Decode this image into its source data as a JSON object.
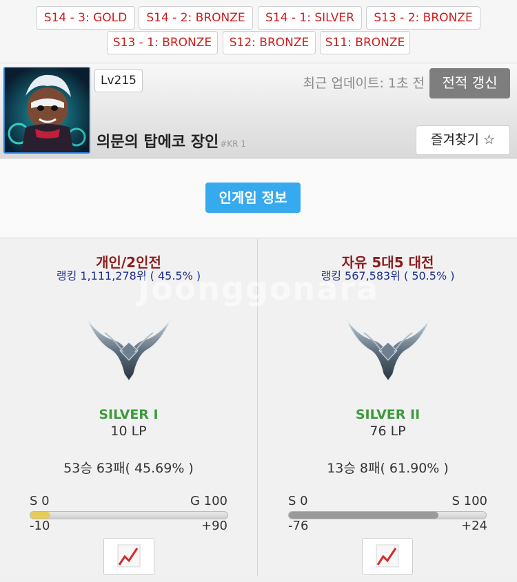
{
  "seasons": [
    {
      "label": "S14 - 3: GOLD"
    },
    {
      "label": "S14 - 2: BRONZE"
    },
    {
      "label": "S14 - 1: SILVER"
    },
    {
      "label": "S13 - 2: BRONZE"
    },
    {
      "label": "S13 - 1: BRONZE"
    },
    {
      "label": "S12: BRONZE"
    },
    {
      "label": "S11: BRONZE"
    }
  ],
  "profile": {
    "level": "Lv215",
    "last_update": "최근 업데이트: 1초 전",
    "refresh_label": "전적 갱신",
    "summoner_name": "의문의 탑에코 장인",
    "tag": "#KR 1",
    "favorite_label": "즐겨찾기 ☆"
  },
  "ingame_label": "인게임 정보",
  "watermark": "Joonggonara",
  "queues": [
    {
      "name": "개인/2인전",
      "ranking": "랭킹 1,111,278위 ( 45.5% )",
      "tier": "SILVER I",
      "lp": "10 LP",
      "record": "53승 63패( 45.69% )",
      "bar_left": "S 0",
      "bar_right": "G 100",
      "bar_min": "-10",
      "bar_max": "+90",
      "progress": 0.1,
      "bar_color": "#e7cc5a"
    },
    {
      "name": "자유 5대5 대전",
      "ranking": "랭킹 567,583위 ( 50.5% )",
      "tier": "SILVER II",
      "lp": "76 LP",
      "record": "13승 8패( 61.90% )",
      "bar_left": "S 0",
      "bar_right": "S 100",
      "bar_min": "-76",
      "bar_max": "+24",
      "progress": 0.76,
      "bar_color": "#9a9a9a"
    }
  ],
  "colors": {
    "season_text": "#d01c1c",
    "queue_title": "#8b1d1d",
    "ranking_text": "#1d2e8e",
    "tier_text": "#3d9a3d",
    "ingame_button": "#37a9ef",
    "refresh_button": "#7e7e7e"
  },
  "icons": {
    "graph": "line-chart-icon",
    "emblem": "silver-rank-emblem",
    "avatar": "champion-avatar"
  }
}
